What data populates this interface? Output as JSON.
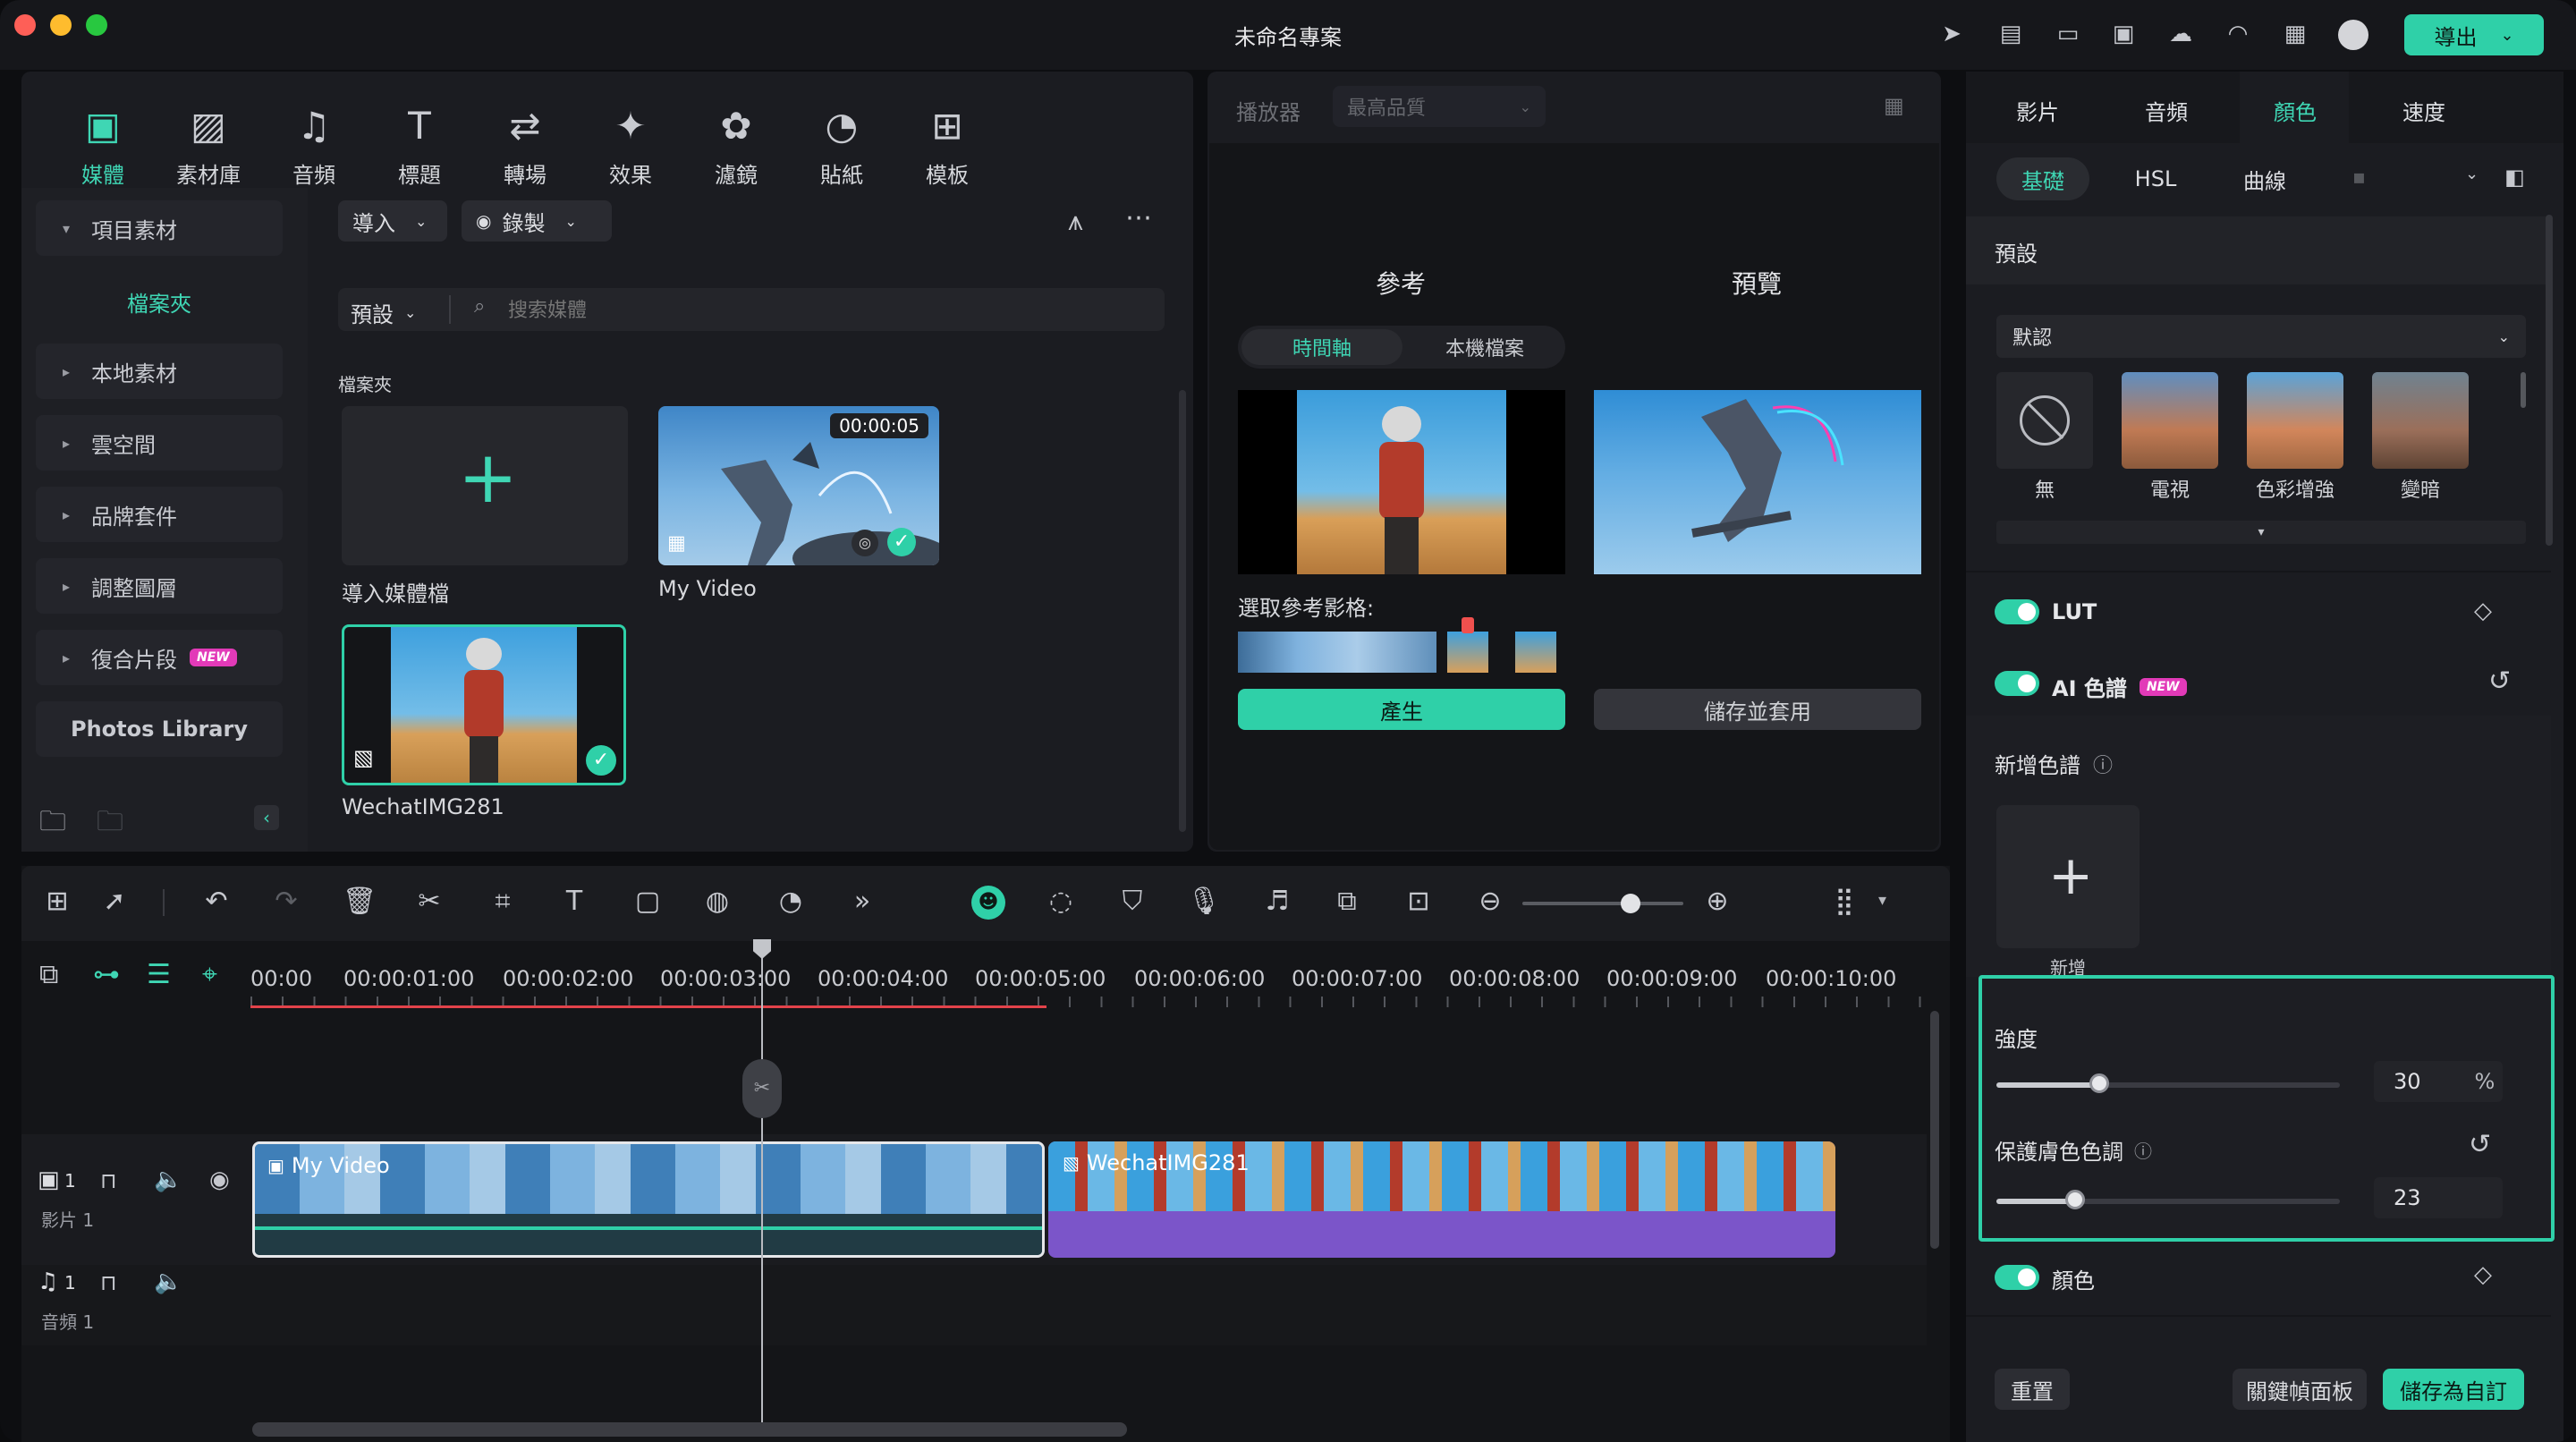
{
  "window": {
    "title": "未命名專案",
    "export_label": "導出"
  },
  "colors": {
    "accent": "#2fd0a8",
    "purple_clip": "#7b55c9",
    "new_badge": "#e23ab8",
    "highlight_border": "#2fd0a8"
  },
  "media_tabs": [
    {
      "label": "媒體",
      "icon": "media-icon",
      "active": true
    },
    {
      "label": "素材庫",
      "icon": "stock-media-icon"
    },
    {
      "label": "音頻",
      "icon": "music-note-icon"
    },
    {
      "label": "標題",
      "icon": "title-text-icon"
    },
    {
      "label": "轉場",
      "icon": "transition-icon"
    },
    {
      "label": "效果",
      "icon": "effects-icon"
    },
    {
      "label": "濾鏡",
      "icon": "filters-icon"
    },
    {
      "label": "貼紙",
      "icon": "sticker-icon"
    },
    {
      "label": "模板",
      "icon": "template-icon"
    }
  ],
  "sidebar": {
    "items": [
      {
        "label": "項目素材"
      },
      {
        "label": "檔案夾"
      },
      {
        "label": "本地素材"
      },
      {
        "label": "雲空間"
      },
      {
        "label": "品牌套件"
      },
      {
        "label": "調整圖層"
      },
      {
        "label": "復合片段",
        "badge": "NEW"
      },
      {
        "label": "Photos Library"
      }
    ]
  },
  "media": {
    "import_label": "導入",
    "record_label": "錄製",
    "preset_label": "預設",
    "search_placeholder": "搜索媒體",
    "folder_label": "檔案夾",
    "items": [
      {
        "name": "導入媒體檔"
      },
      {
        "name": "My Video",
        "duration": "00:00:05"
      },
      {
        "name": "WechatIMG281"
      }
    ]
  },
  "player": {
    "label": "播放器",
    "quality": "最高品質",
    "reference_title": "參考",
    "preview_title": "預覽",
    "segments": [
      "時間軸",
      "本機檔案"
    ],
    "select_frame_label": "選取參考影格:",
    "generate_label": "產生",
    "save_apply_label": "儲存並套用"
  },
  "timeline": {
    "ruler": [
      "00:00",
      "00:00:01:00",
      "00:00:02:00",
      "00:00:03:00",
      "00:00:04:00",
      "00:00:05:00",
      "00:00:06:00",
      "00:00:07:00",
      "00:00:08:00",
      "00:00:09:00",
      "00:00:10:00"
    ],
    "clips": [
      {
        "name": "My Video"
      },
      {
        "name": "WechatIMG281"
      }
    ],
    "tracks": [
      {
        "number": "1",
        "label": "影片 1"
      },
      {
        "number": "1",
        "label": "音頻 1"
      }
    ]
  },
  "right_panel": {
    "tabs": [
      "影片",
      "音頻",
      "顏色",
      "速度"
    ],
    "active_tab": "顏色",
    "subtabs": [
      "基礎",
      "HSL",
      "曲線"
    ],
    "preset_header": "預設",
    "preset_dropdown": "默認",
    "presets": [
      "無",
      "電視",
      "色彩增強",
      "變暗"
    ],
    "lut_label": "LUT",
    "ai_palette_label": "AI 色譜",
    "ai_badge": "NEW",
    "add_palette_label": "新增色譜",
    "add_label": "新增",
    "strength_label": "強度",
    "strength_value": "30",
    "strength_unit": "%",
    "strength_level": 30,
    "skin_label": "保護膚色色調",
    "skin_value": "23",
    "skin_level": 23,
    "color_label": "顏色",
    "reset_label": "重置",
    "keyframe_label": "關鍵幀面板",
    "save_custom_label": "儲存為自訂"
  }
}
